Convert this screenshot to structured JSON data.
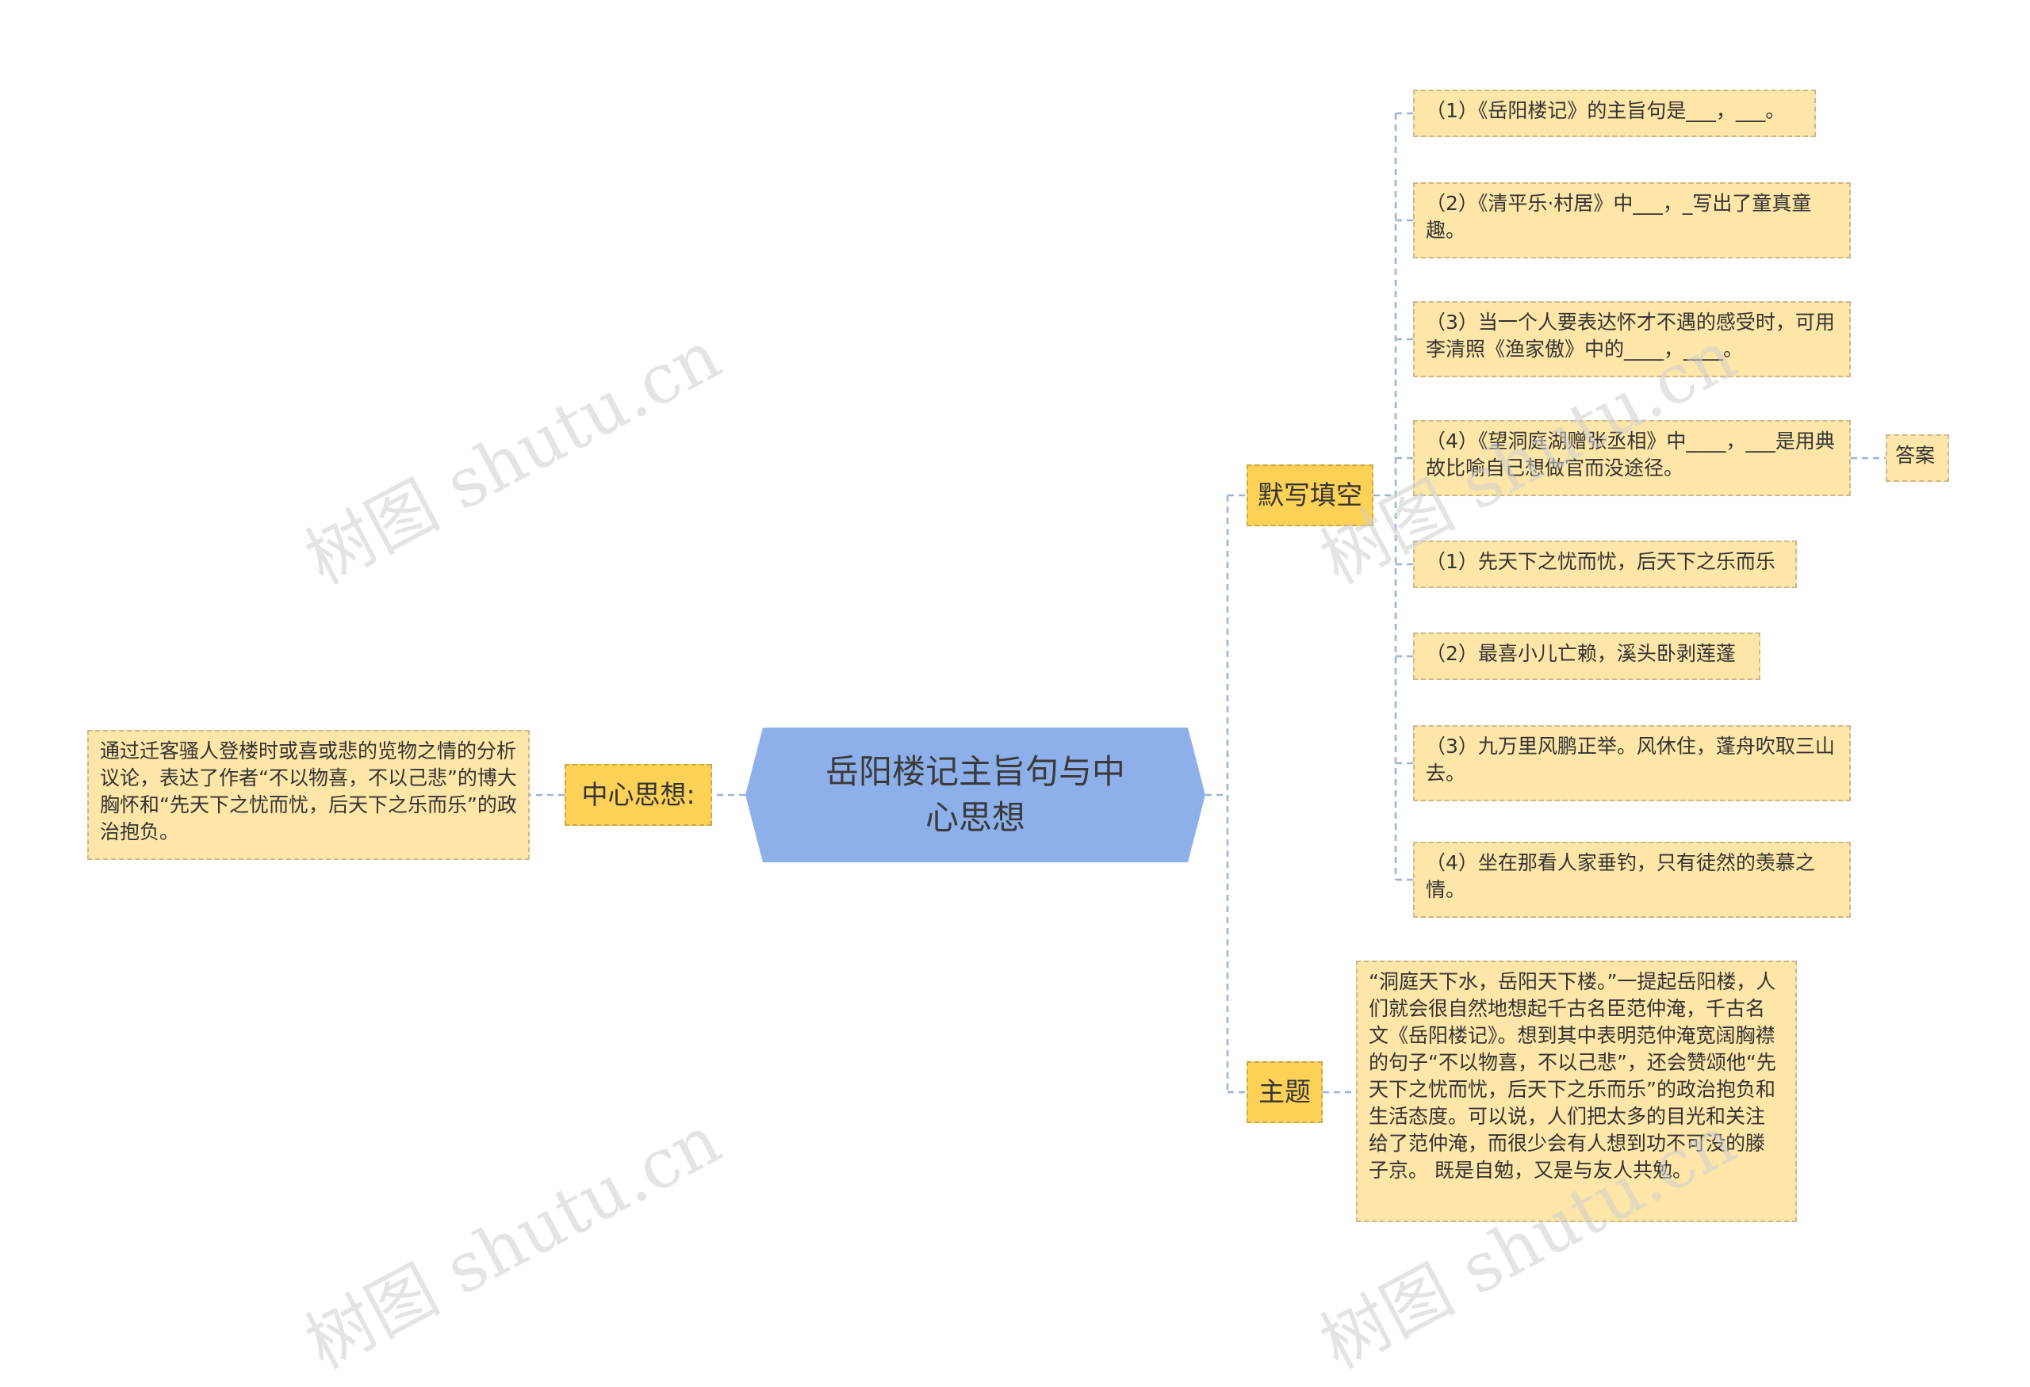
{
  "root": {
    "title": "岳阳楼记主旨句与中心思想"
  },
  "left": {
    "branch_label": "中心思想:",
    "leaf_text": "通过迁客骚人登楼时或喜或悲的览物之情的分析议论，表达了作者“不以物喜，不以己悲”的博大胸怀和“先天下之忧而忧，后天下之乐而乐”的政治抱负。"
  },
  "dictation": {
    "branch_label": "默写填空",
    "answer_label": "答案",
    "items": [
      "（1）《岳阳楼记》的主旨句是___，___。",
      "（2）《清平乐·村居》中___，_写出了童真童趣。",
      "（3）当一个人要表达怀才不遇的感受时，可用李清照《渔家傲》中的____，____。",
      "（4）《望洞庭湖赠张丞相》中____，___是用典故比喻自己想做官而没途径。",
      "（1）先天下之忧而忧，后天下之乐而乐",
      "（2）最喜小儿亡赖，溪头卧剥莲蓬",
      "（3）九万里风鹏正举。风休住，蓬舟吹取三山去。",
      "（4）坐在那看人家垂钓，只有徒然的羡慕之情。"
    ]
  },
  "theme": {
    "branch_label": "主题",
    "leaf_text": "“洞庭天下水，岳阳天下楼。”一提起岳阳楼，人们就会很自然地想起千古名臣范仲淹，千古名文《岳阳楼记》。想到其中表明范仲淹宽阔胸襟的句子“不以物喜，不以己悲”，还会赞颂他“先天下之忧而忧，后天下之乐而乐”的政治抱负和生活态度。可以说，人们把太多的目光和关注给了范仲淹，而很少会有人想到功不可没的滕子京。 既是自勉，又是与友人共勉。"
  },
  "watermark": "树图 shutu.cn",
  "colors": {
    "root_fill": "#8eb0ea",
    "branch_fill": "#fcd155",
    "leaf_fill": "#fde6a7",
    "connector": "#9ab3d6"
  }
}
